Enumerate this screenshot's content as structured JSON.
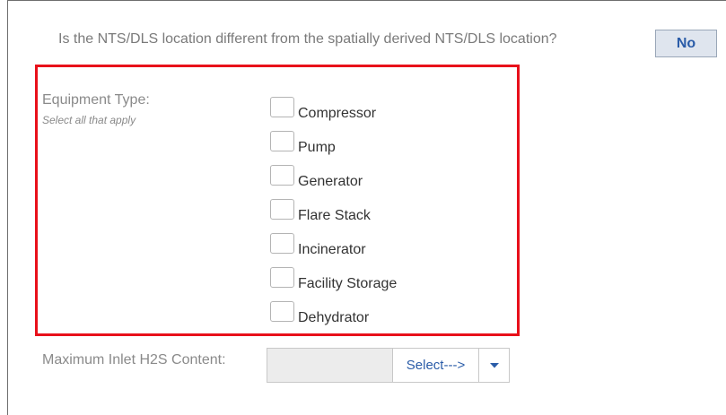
{
  "nts_section": {
    "question": "Is the NTS/DLS location different from the spatially derived NTS/DLS location?",
    "answer_button": "No"
  },
  "equipment": {
    "label": "Equipment Type:",
    "sublabel": "Select all that apply",
    "options": [
      {
        "label": "Compressor",
        "checked": false
      },
      {
        "label": "Pump",
        "checked": false
      },
      {
        "label": "Generator",
        "checked": false
      },
      {
        "label": "Flare Stack",
        "checked": false
      },
      {
        "label": "Incinerator",
        "checked": false
      },
      {
        "label": "Facility Storage",
        "checked": false
      },
      {
        "label": "Dehydrator",
        "checked": false
      }
    ]
  },
  "h2s": {
    "label": "Maximum Inlet H2S Content:",
    "input_value": "",
    "select_value": "Select--->"
  },
  "colors": {
    "highlight_border": "#e8101a",
    "link_blue": "#2a5ca8",
    "button_bg": "#dfe5ee"
  },
  "icons": {
    "select_arrow": "caret-down-icon"
  }
}
